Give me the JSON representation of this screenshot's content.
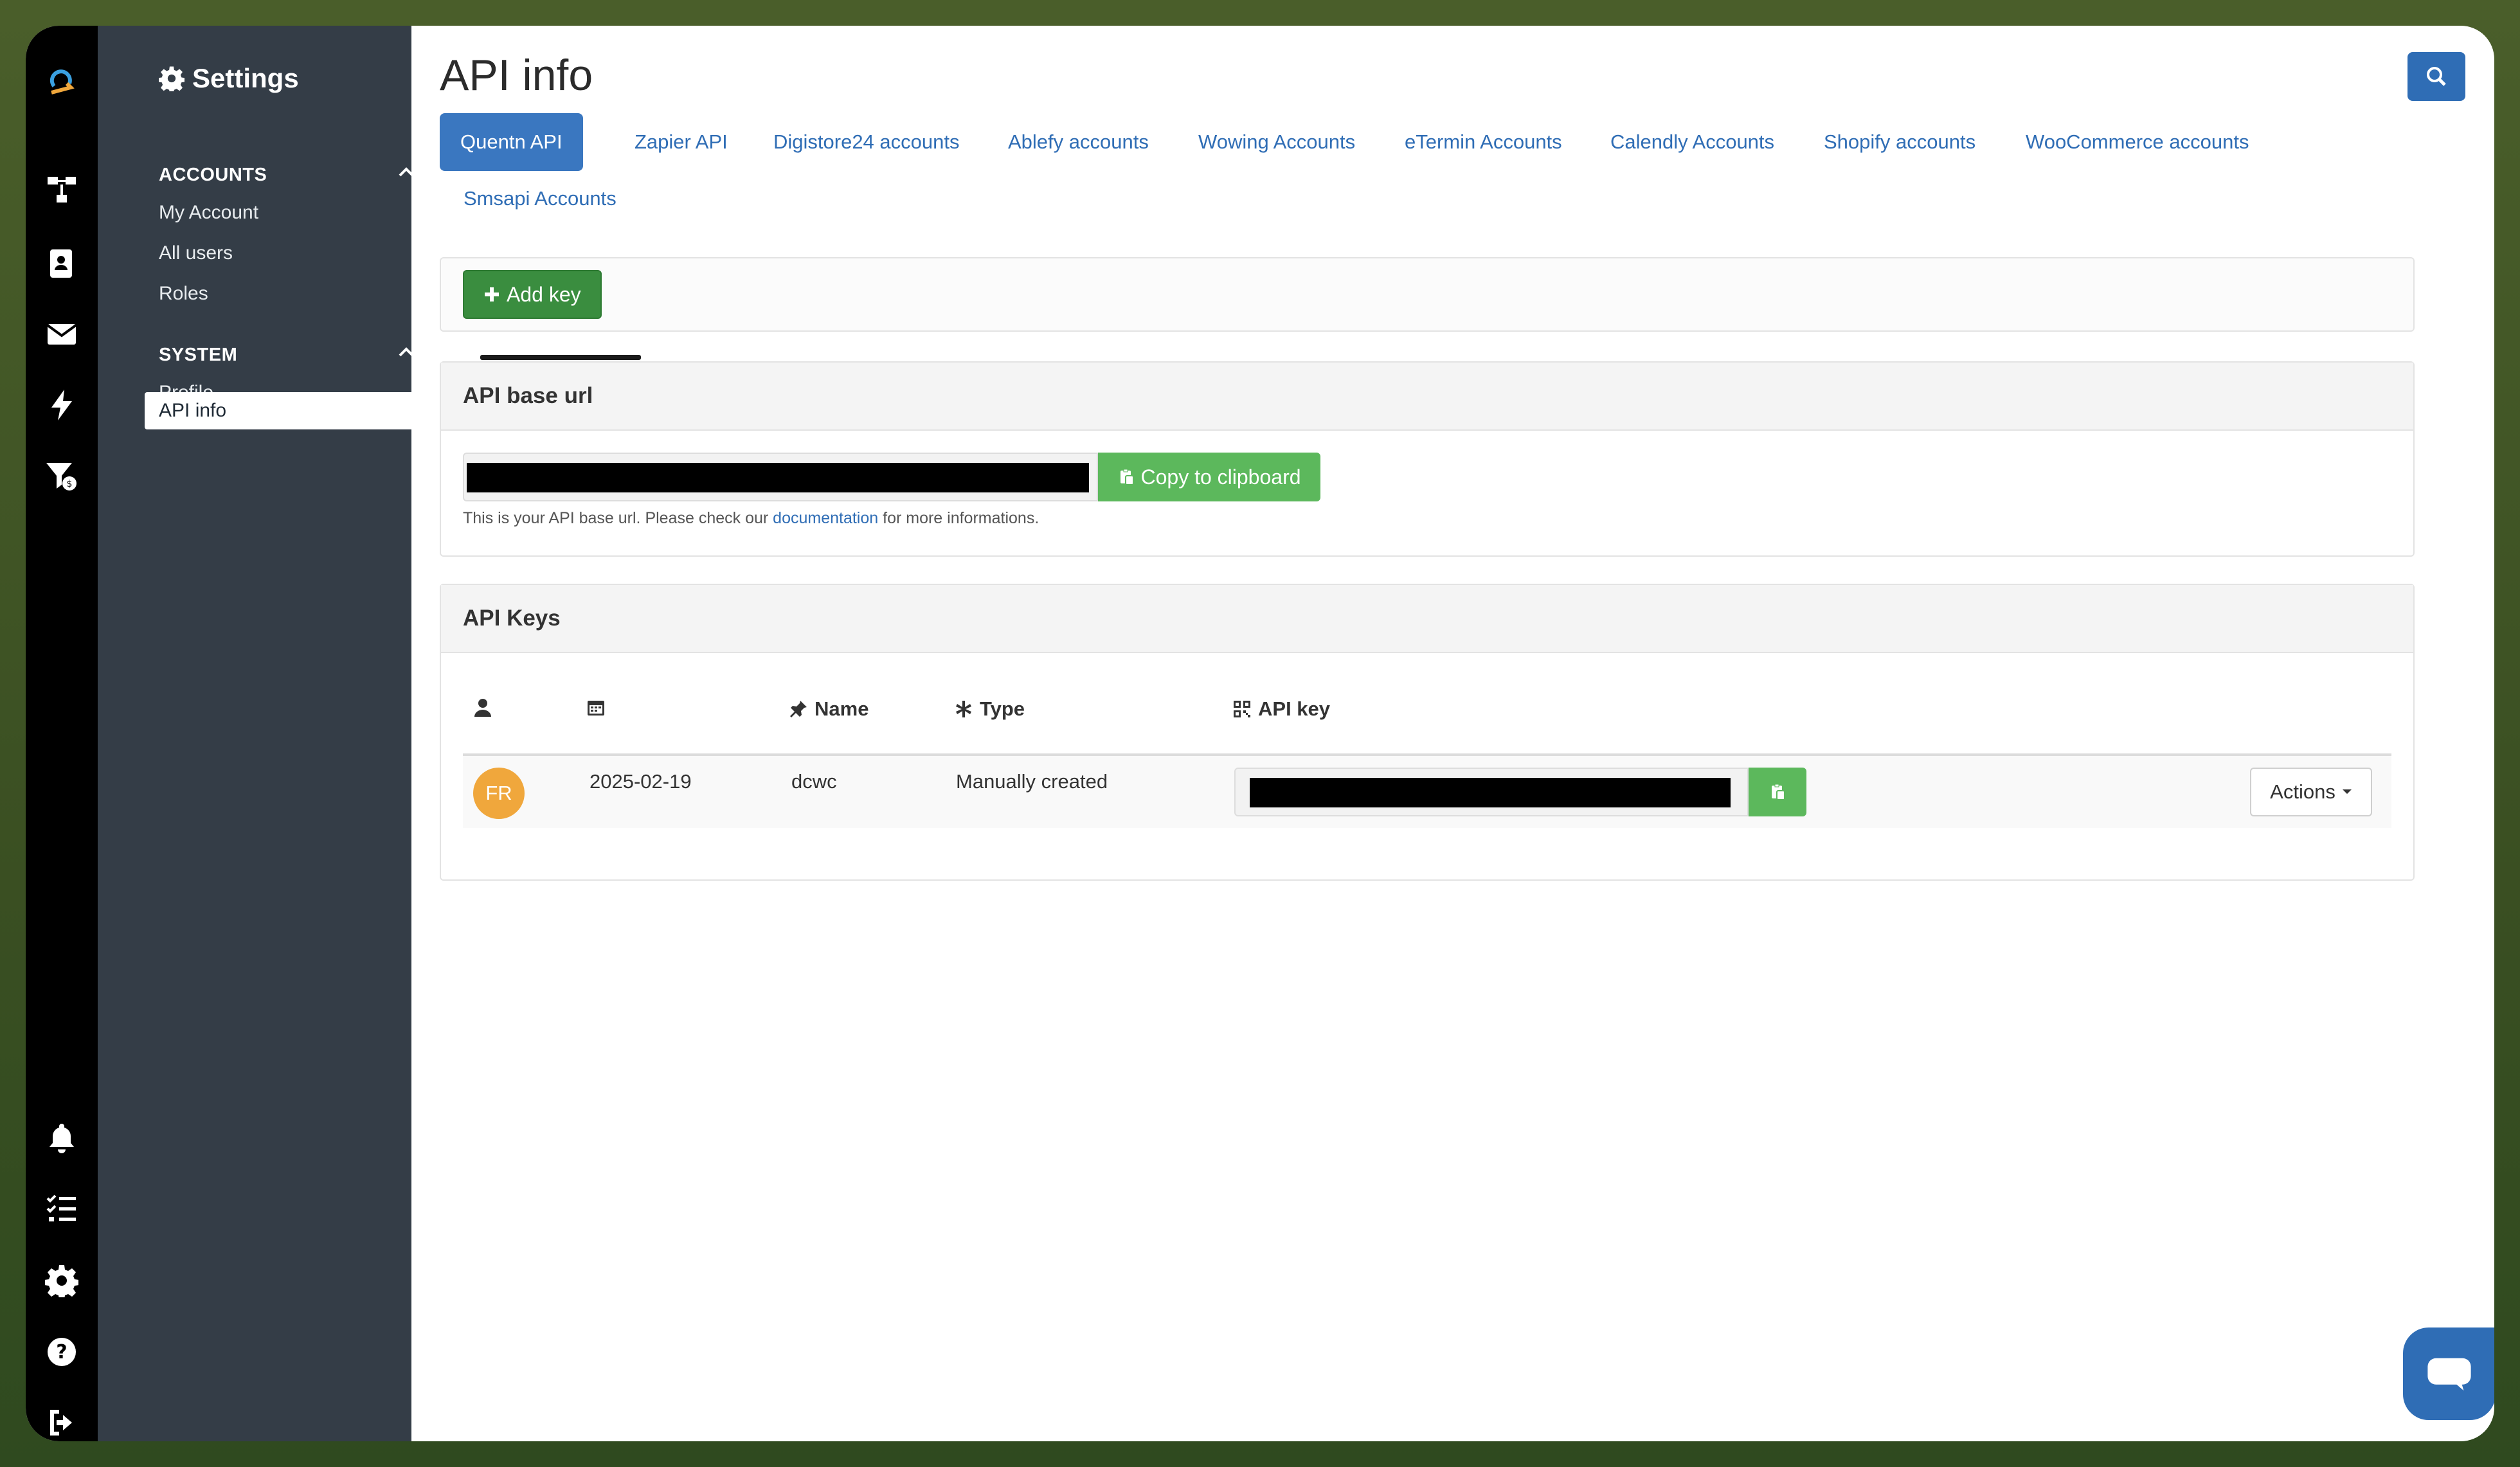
{
  "sidebar": {
    "title": "Settings",
    "sections": [
      {
        "label": "ACCOUNTS",
        "items": [
          "My Account",
          "All users",
          "Roles"
        ]
      },
      {
        "label": "SYSTEM",
        "items": [
          "Profile",
          "API info"
        ]
      }
    ],
    "active_item": "API info"
  },
  "page": {
    "title": "API info"
  },
  "tabs": [
    {
      "label": "Quentn API",
      "active": true
    },
    {
      "label": "Zapier API"
    },
    {
      "label": "Digistore24 accounts"
    },
    {
      "label": "Ablefy accounts"
    },
    {
      "label": "Wowing Accounts"
    },
    {
      "label": "eTermin Accounts"
    },
    {
      "label": "Calendly Accounts"
    },
    {
      "label": "Shopify accounts"
    },
    {
      "label": "WooCommerce accounts"
    },
    {
      "label": "Smsapi Accounts"
    }
  ],
  "toolbar": {
    "add_key_label": "Add key"
  },
  "base_url_panel": {
    "title": "API base url",
    "copy_label": "Copy to clipboard",
    "help_prefix": "This is your API base url. Please check our ",
    "help_link": "documentation",
    "help_suffix": " for more informations."
  },
  "keys_panel": {
    "title": "API Keys",
    "columns": [
      "",
      "",
      "Name",
      "Type",
      "API key"
    ],
    "rows": [
      {
        "avatar": "FR",
        "date": "2025-02-19",
        "name": "dcwc",
        "type": "Manually created"
      }
    ],
    "actions_label": "Actions"
  },
  "colors": {
    "primary": "#2f6db5",
    "success": "#5cb85c",
    "sidebar_bg": "#343d47",
    "rail_bg": "#000000",
    "avatar": "#f0a73c"
  }
}
